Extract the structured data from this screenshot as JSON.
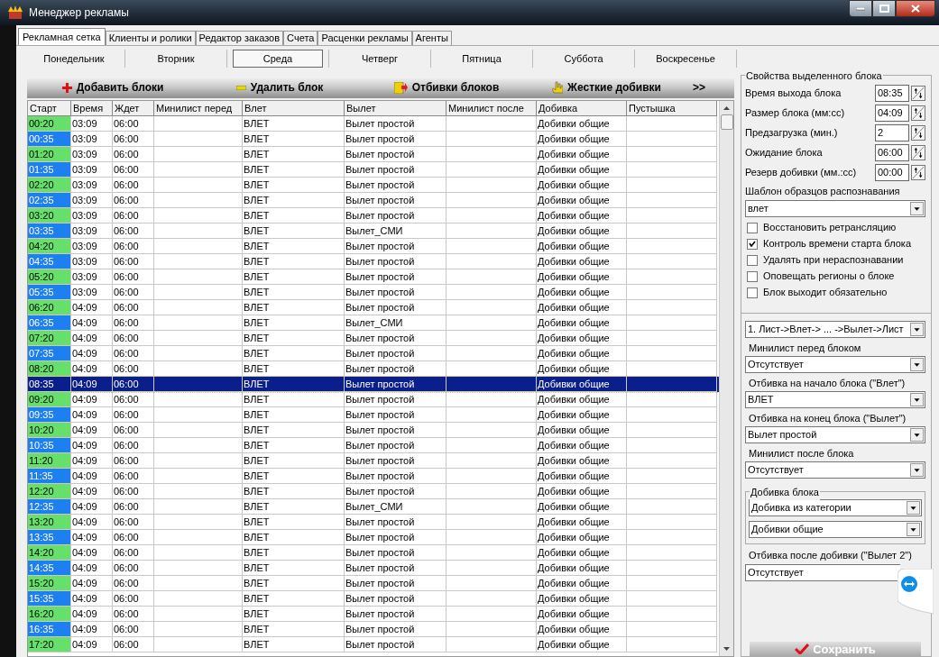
{
  "window": {
    "title": "Менеджер рекламы"
  },
  "tabs": [
    {
      "label": "Рекламная сетка",
      "selected": true
    },
    {
      "label": "Клиенты и ролики",
      "selected": false
    },
    {
      "label": "Редактор заказов",
      "selected": false
    },
    {
      "label": "Счета",
      "selected": false
    },
    {
      "label": "Расценки рекламы",
      "selected": false
    },
    {
      "label": "Агенты",
      "selected": false
    }
  ],
  "days": [
    {
      "label": "Понедельник",
      "selected": false
    },
    {
      "label": "Вторник",
      "selected": false
    },
    {
      "label": "Среда",
      "selected": true
    },
    {
      "label": "Четверг",
      "selected": false
    },
    {
      "label": "Пятница",
      "selected": false
    },
    {
      "label": "Суббота",
      "selected": false
    },
    {
      "label": "Воскресенье",
      "selected": false
    }
  ],
  "toolbar": [
    {
      "kind": "add",
      "label": "Добавить блоки"
    },
    {
      "kind": "remove",
      "label": "Удалить блок"
    },
    {
      "kind": "jingles",
      "label": "Отбивки блоков"
    },
    {
      "kind": "hard",
      "label": "Жесткие добивки"
    },
    {
      "kind": "more",
      "label": ">>"
    }
  ],
  "table": {
    "columns": [
      "Старт",
      "Время",
      "Ждет",
      "Минилист перед",
      "Влет",
      "Вылет",
      "Минилист после",
      "Добивка",
      "Пустышка"
    ],
    "rows": [
      {
        "start": "00:20",
        "color": "#66e06a",
        "duration": "03:09",
        "wait": "06:00",
        "entry": "ВЛЕТ",
        "exit": "Вылет простой",
        "filler": "Добивки общие",
        "selected": false
      },
      {
        "start": "00:35",
        "color": "#1e7ff0",
        "duration": "03:09",
        "wait": "06:00",
        "entry": "ВЛЕТ",
        "exit": "Вылет простой",
        "filler": "Добивки общие",
        "selected": false
      },
      {
        "start": "01:20",
        "color": "#66e06a",
        "duration": "03:09",
        "wait": "06:00",
        "entry": "ВЛЕТ",
        "exit": "Вылет простой",
        "filler": "Добивки общие",
        "selected": false
      },
      {
        "start": "01:35",
        "color": "#1e7ff0",
        "duration": "03:09",
        "wait": "06:00",
        "entry": "ВЛЕТ",
        "exit": "Вылет простой",
        "filler": "Добивки общие",
        "selected": false
      },
      {
        "start": "02:20",
        "color": "#66e06a",
        "duration": "03:09",
        "wait": "06:00",
        "entry": "ВЛЕТ",
        "exit": "Вылет простой",
        "filler": "Добивки общие",
        "selected": false
      },
      {
        "start": "02:35",
        "color": "#1e7ff0",
        "duration": "03:09",
        "wait": "06:00",
        "entry": "ВЛЕТ",
        "exit": "Вылет простой",
        "filler": "Добивки общие",
        "selected": false
      },
      {
        "start": "03:20",
        "color": "#66e06a",
        "duration": "03:09",
        "wait": "06:00",
        "entry": "ВЛЕТ",
        "exit": "Вылет простой",
        "filler": "Добивки общие",
        "selected": false
      },
      {
        "start": "03:35",
        "color": "#1e7ff0",
        "duration": "03:09",
        "wait": "06:00",
        "entry": "ВЛЕТ",
        "exit": "Вылет_СМИ",
        "filler": "Добивки общие",
        "selected": false
      },
      {
        "start": "04:20",
        "color": "#66e06a",
        "duration": "03:09",
        "wait": "06:00",
        "entry": "ВЛЕТ",
        "exit": "Вылет простой",
        "filler": "Добивки общие",
        "selected": false
      },
      {
        "start": "04:35",
        "color": "#1e7ff0",
        "duration": "03:09",
        "wait": "06:00",
        "entry": "ВЛЕТ",
        "exit": "Вылет простой",
        "filler": "Добивки общие",
        "selected": false
      },
      {
        "start": "05:20",
        "color": "#66e06a",
        "duration": "03:09",
        "wait": "06:00",
        "entry": "ВЛЕТ",
        "exit": "Вылет простой",
        "filler": "Добивки общие",
        "selected": false
      },
      {
        "start": "05:35",
        "color": "#1e7ff0",
        "duration": "03:09",
        "wait": "06:00",
        "entry": "ВЛЕТ",
        "exit": "Вылет простой",
        "filler": "Добивки общие",
        "selected": false
      },
      {
        "start": "06:20",
        "color": "#66e06a",
        "duration": "04:09",
        "wait": "06:00",
        "entry": "ВЛЕТ",
        "exit": "Вылет простой",
        "filler": "Добивки общие",
        "selected": false
      },
      {
        "start": "06:35",
        "color": "#1e7ff0",
        "duration": "04:09",
        "wait": "06:00",
        "entry": "ВЛЕТ",
        "exit": "Вылет_СМИ",
        "filler": "Добивки общие",
        "selected": false
      },
      {
        "start": "07:20",
        "color": "#66e06a",
        "duration": "04:09",
        "wait": "06:00",
        "entry": "ВЛЕТ",
        "exit": "Вылет простой",
        "filler": "Добивки общие",
        "selected": false
      },
      {
        "start": "07:35",
        "color": "#1e7ff0",
        "duration": "04:09",
        "wait": "06:00",
        "entry": "ВЛЕТ",
        "exit": "Вылет простой",
        "filler": "Добивки общие",
        "selected": false
      },
      {
        "start": "08:20",
        "color": "#66e06a",
        "duration": "04:09",
        "wait": "06:00",
        "entry": "ВЛЕТ",
        "exit": "Вылет простой",
        "filler": "Добивки общие",
        "selected": false
      },
      {
        "start": "08:35",
        "duration": "04:09",
        "wait": "06:00",
        "entry": "ВЛЕТ",
        "exit": "Вылет простой",
        "filler": "Добивки общие",
        "selected": true
      },
      {
        "start": "09:20",
        "color": "#66e06a",
        "duration": "04:09",
        "wait": "06:00",
        "entry": "ВЛЕТ",
        "exit": "Вылет простой",
        "filler": "Добивки общие",
        "selected": false
      },
      {
        "start": "09:35",
        "color": "#1e7ff0",
        "duration": "04:09",
        "wait": "06:00",
        "entry": "ВЛЕТ",
        "exit": "Вылет простой",
        "filler": "Добивки общие",
        "selected": false
      },
      {
        "start": "10:20",
        "color": "#66e06a",
        "duration": "04:09",
        "wait": "06:00",
        "entry": "ВЛЕТ",
        "exit": "Вылет простой",
        "filler": "Добивки общие",
        "selected": false
      },
      {
        "start": "10:35",
        "color": "#1e7ff0",
        "duration": "04:09",
        "wait": "06:00",
        "entry": "ВЛЕТ",
        "exit": "Вылет простой",
        "filler": "Добивки общие",
        "selected": false
      },
      {
        "start": "11:20",
        "color": "#66e06a",
        "duration": "04:09",
        "wait": "06:00",
        "entry": "ВЛЕТ",
        "exit": "Вылет простой",
        "filler": "Добивки общие",
        "selected": false
      },
      {
        "start": "11:35",
        "color": "#1e7ff0",
        "duration": "04:09",
        "wait": "06:00",
        "entry": "ВЛЕТ",
        "exit": "Вылет простой",
        "filler": "Добивки общие",
        "selected": false
      },
      {
        "start": "12:20",
        "color": "#66e06a",
        "duration": "04:09",
        "wait": "06:00",
        "entry": "ВЛЕТ",
        "exit": "Вылет простой",
        "filler": "Добивки общие",
        "selected": false
      },
      {
        "start": "12:35",
        "color": "#1e7ff0",
        "duration": "04:09",
        "wait": "06:00",
        "entry": "ВЛЕТ",
        "exit": "Вылет_СМИ",
        "filler": "Добивки общие",
        "selected": false
      },
      {
        "start": "13:20",
        "color": "#66e06a",
        "duration": "04:09",
        "wait": "06:00",
        "entry": "ВЛЕТ",
        "exit": "Вылет простой",
        "filler": "Добивки общие",
        "selected": false
      },
      {
        "start": "13:35",
        "color": "#1e7ff0",
        "duration": "04:09",
        "wait": "06:00",
        "entry": "ВЛЕТ",
        "exit": "Вылет простой",
        "filler": "Добивки общие",
        "selected": false
      },
      {
        "start": "14:20",
        "color": "#66e06a",
        "duration": "04:09",
        "wait": "06:00",
        "entry": "ВЛЕТ",
        "exit": "Вылет простой",
        "filler": "Добивки общие",
        "selected": false
      },
      {
        "start": "14:35",
        "color": "#1e7ff0",
        "duration": "04:09",
        "wait": "06:00",
        "entry": "ВЛЕТ",
        "exit": "Вылет простой",
        "filler": "Добивки общие",
        "selected": false
      },
      {
        "start": "15:20",
        "color": "#66e06a",
        "duration": "04:09",
        "wait": "06:00",
        "entry": "ВЛЕТ",
        "exit": "Вылет простой",
        "filler": "Добивки общие",
        "selected": false
      },
      {
        "start": "15:35",
        "color": "#1e7ff0",
        "duration": "04:09",
        "wait": "06:00",
        "entry": "ВЛЕТ",
        "exit": "Вылет простой",
        "filler": "Добивки общие",
        "selected": false
      },
      {
        "start": "16:20",
        "color": "#66e06a",
        "duration": "04:09",
        "wait": "06:00",
        "entry": "ВЛЕТ",
        "exit": "Вылет простой",
        "filler": "Добивки общие",
        "selected": false
      },
      {
        "start": "16:35",
        "color": "#1e7ff0",
        "duration": "04:09",
        "wait": "06:00",
        "entry": "ВЛЕТ",
        "exit": "Вылет простой",
        "filler": "Добивки общие",
        "selected": false
      },
      {
        "start": "17:20",
        "color": "#66e06a",
        "duration": "04:09",
        "wait": "06:00",
        "entry": "ВЛЕТ",
        "exit": "Вылет простой",
        "filler": "Добивки общие",
        "selected": false
      }
    ]
  },
  "properties": {
    "title": "Свойства выделенного блока",
    "spinners": [
      {
        "label": "Время выхода блока",
        "value": "08:35"
      },
      {
        "label": "Размер блока (мм:сс)",
        "value": "04:09"
      },
      {
        "label": "Предзагрузка (мин.)",
        "value": "2"
      },
      {
        "label": "Ожидание блока",
        "value": "06:00"
      },
      {
        "label": "Резерв добивки (мм.:сс)",
        "value": "00:00"
      }
    ],
    "template": {
      "label": "Шаблон образцов распознавания",
      "value": "влет"
    },
    "checkboxes": [
      {
        "label": "Восстановить ретрансляцию",
        "checked": false
      },
      {
        "label": "Контроль времени старта блока",
        "checked": true
      },
      {
        "label": "Удалять при нераспознавании",
        "checked": false
      },
      {
        "label": "Оповещать регионы о блоке",
        "checked": false
      },
      {
        "label": "Блок выходит обязательно",
        "checked": false
      }
    ],
    "order": {
      "value": "1. Лист->Влет-> ... ->Вылет->Лист"
    },
    "dropdowns": [
      {
        "label": "Минилист перед блоком",
        "value": "Отсутствует"
      },
      {
        "label": "Отбивка на начало блока (\"Влет\")",
        "value": "ВЛЕТ"
      },
      {
        "label": "Отбивка на конец блока (\"Вылет\")",
        "value": "Вылет простой"
      },
      {
        "label": "Минилист после блока",
        "value": "Отсутствует"
      }
    ],
    "filler_group": {
      "title": "Добивка блока",
      "values": [
        "Добивка из категории",
        "Добивки общие"
      ]
    },
    "after_filler": {
      "label": "Отбивка после добивки (\"Вылет 2\")",
      "value": "Отсутствует"
    },
    "save_button": "Сохранить"
  }
}
